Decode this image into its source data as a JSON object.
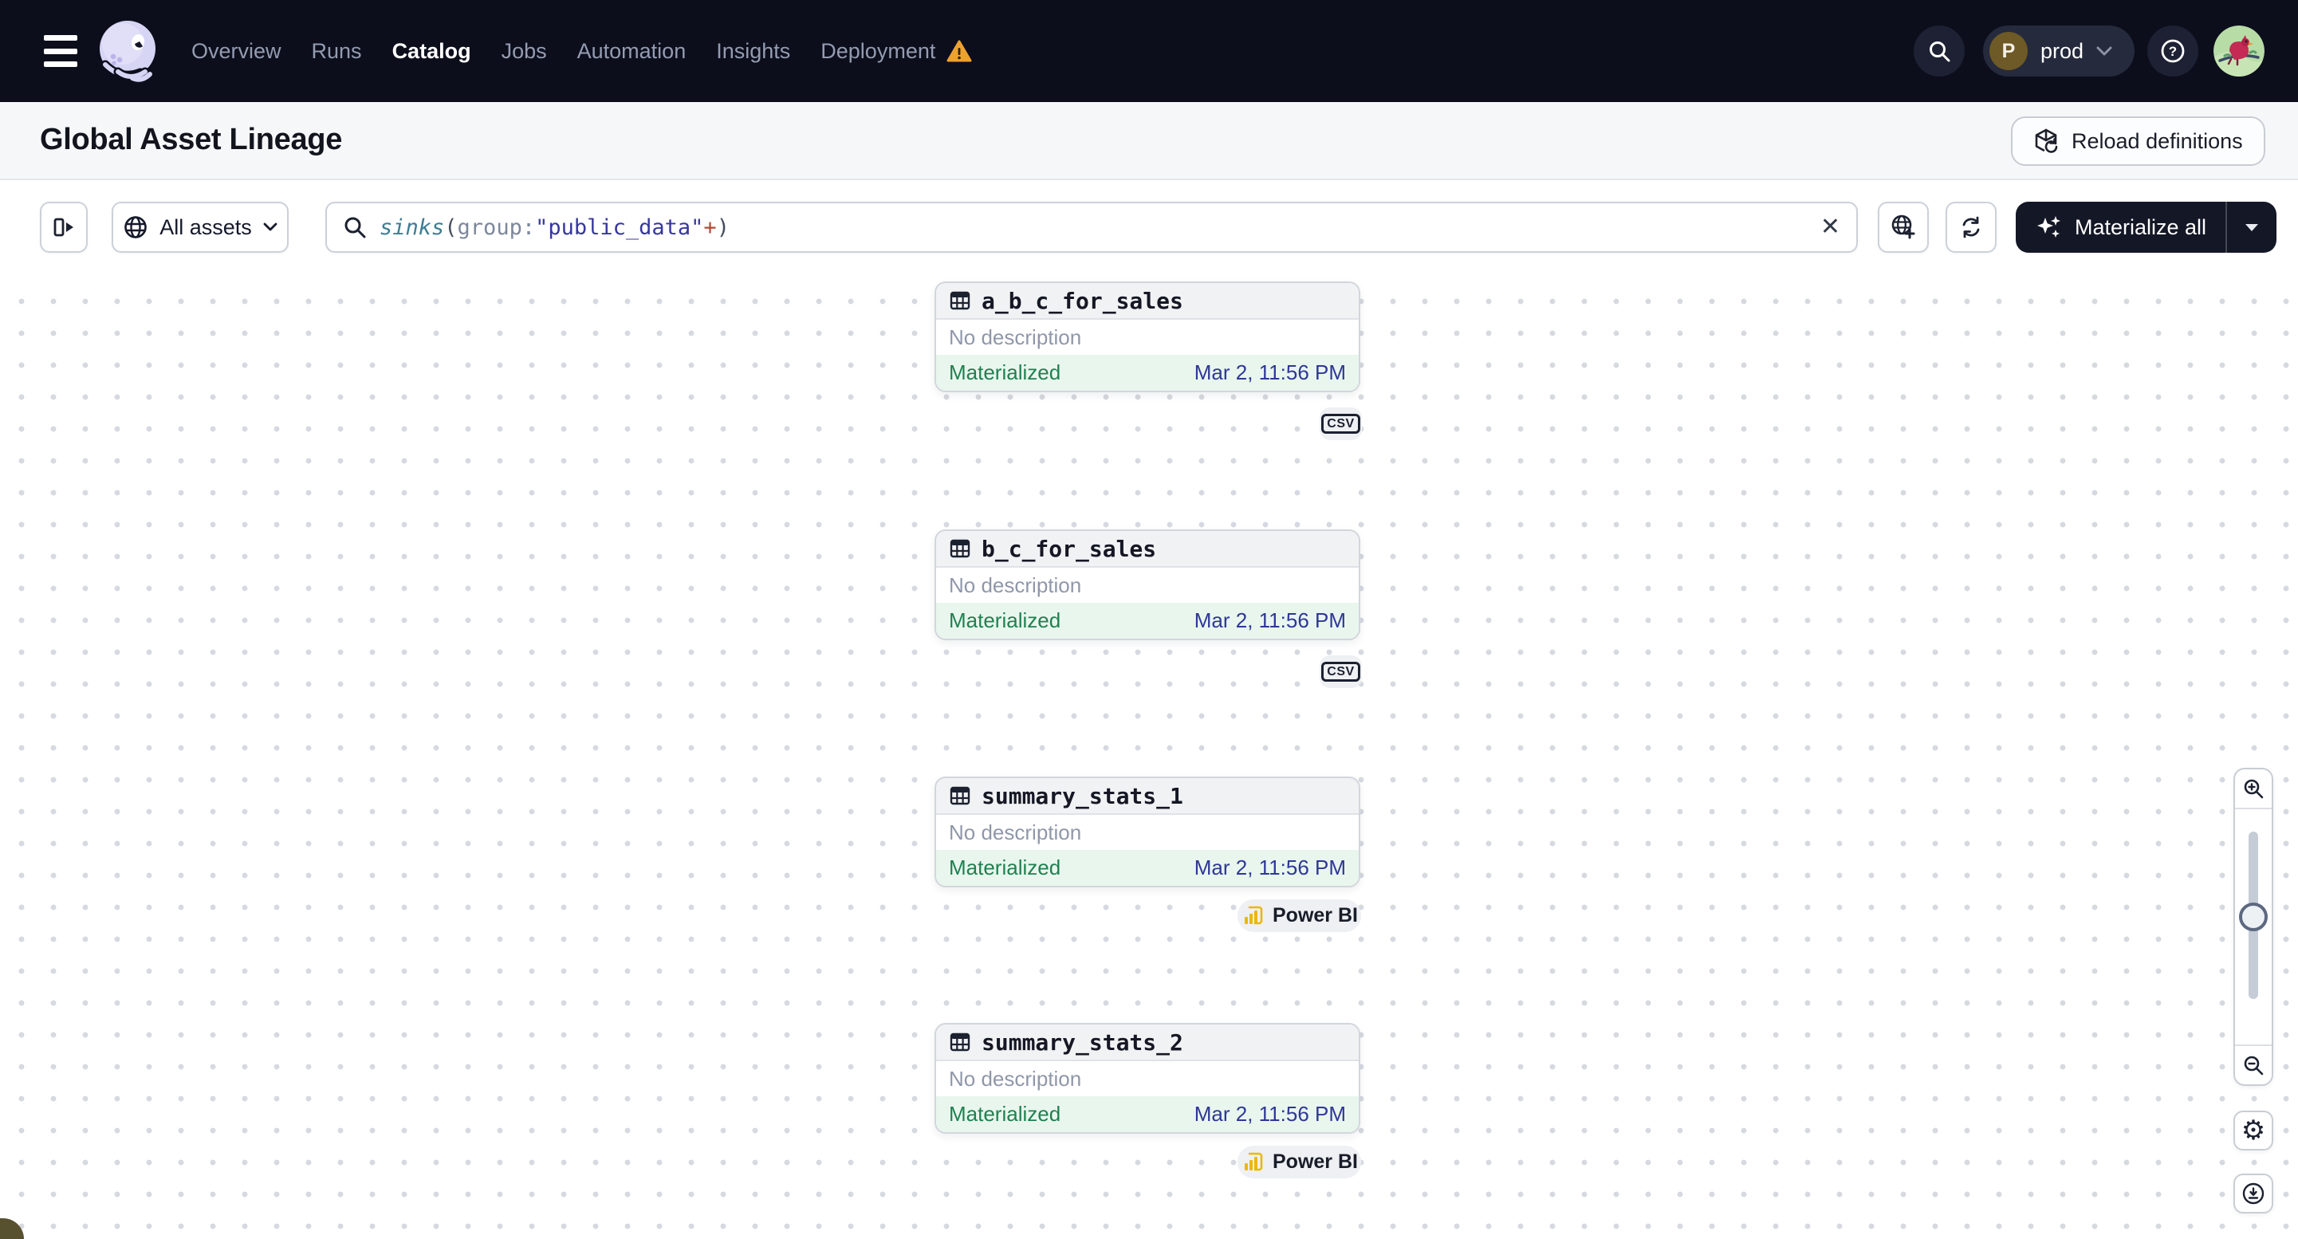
{
  "nav": {
    "items": [
      {
        "label": "Overview"
      },
      {
        "label": "Runs"
      },
      {
        "label": "Catalog",
        "active": true
      },
      {
        "label": "Jobs"
      },
      {
        "label": "Automation"
      },
      {
        "label": "Insights"
      },
      {
        "label": "Deployment",
        "warning": true
      }
    ],
    "environment": {
      "initial": "P",
      "name": "prod"
    }
  },
  "header": {
    "title": "Global Asset Lineage",
    "reload_button": "Reload definitions"
  },
  "toolbar": {
    "asset_filter_label": "All assets",
    "search": {
      "query_parts": {
        "function": "sinks",
        "paren_open": "(",
        "attribute": "group:",
        "value": "\"public_data\"",
        "operator": "+",
        "paren_close": ")"
      }
    },
    "materialize_button": "Materialize all"
  },
  "canvas": {
    "assets": [
      {
        "name": "a_b_c_for_sales",
        "description": "No description",
        "status": "Materialized",
        "timestamp": "Mar 2, 11:56 PM",
        "kind": "CSV"
      },
      {
        "name": "b_c_for_sales",
        "description": "No description",
        "status": "Materialized",
        "timestamp": "Mar 2, 11:56 PM",
        "kind": "CSV"
      },
      {
        "name": "summary_stats_1",
        "description": "No description",
        "status": "Materialized",
        "timestamp": "Mar 2, 11:56 PM",
        "kind": "Power BI"
      },
      {
        "name": "summary_stats_2",
        "description": "No description",
        "status": "Materialized",
        "timestamp": "Mar 2, 11:56 PM",
        "kind": "Power BI"
      }
    ]
  },
  "colors": {
    "nav_bg": "#0c0e1c",
    "status_green": "#1f8150",
    "status_bg": "#e9f6ee",
    "timestamp_blue": "#2f3796",
    "warning_orange": "#eda12f",
    "powerbi_yellow": "#e9b80d",
    "logo_lavender": "#d7d5f4"
  },
  "icons": {
    "hamburger-menu": "three-bars",
    "dagster-logo": "octopus",
    "search": "magnifier",
    "help": "circled-question",
    "chevron-down": "v",
    "reload": "cube-refresh",
    "panel-toggle": "bar-arrow-right",
    "globe": "globe",
    "clear": "x",
    "add-to-graph": "globe-plus",
    "refresh": "cycle-arrows",
    "sparkles": "stars",
    "caret-down": "triangle",
    "table": "spreadsheet-grid",
    "csv": "boxed-csv",
    "power-bi": "yellow-bars",
    "zoom-in": "magnifier-plus",
    "zoom-out": "magnifier-minus",
    "settings": "gear",
    "download": "circled-arrow-down"
  }
}
